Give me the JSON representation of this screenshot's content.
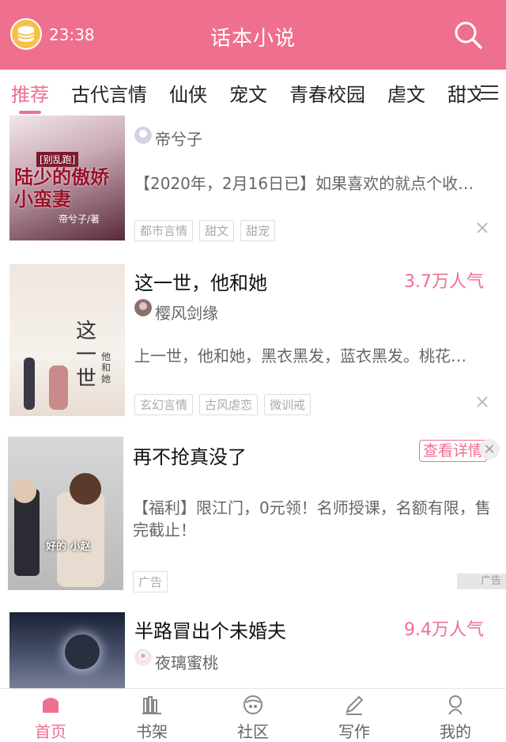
{
  "status": {
    "time": "23:38"
  },
  "header": {
    "title": "话本小说",
    "coin_icon": "coin-icon",
    "search_icon": "search-icon"
  },
  "tabs": [
    {
      "label": "推荐",
      "active": true
    },
    {
      "label": "古代言情"
    },
    {
      "label": "仙侠"
    },
    {
      "label": "宠文"
    },
    {
      "label": "青春校园"
    },
    {
      "label": "虐文"
    },
    {
      "label": "甜文"
    }
  ],
  "cards": [
    {
      "cover_text": {
        "top": "[别乱跑]",
        "main": "陆少的傲娇小蛮妻",
        "author": "帝兮子/著"
      },
      "author": "帝兮子",
      "desc": "【2020年，2月16日已】如果喜欢的就点个收藏…",
      "tags": [
        "都市言情",
        "甜文",
        "甜宠"
      ]
    },
    {
      "title": "这一世，他和她",
      "popularity": "3.7万人气",
      "author": "樱风剑缘",
      "desc": "上一世，他和她，黑衣黑发，蓝衣黑发。桃花…",
      "tags": [
        "玄幻言情",
        "古风虐恋",
        "微训戒"
      ],
      "cover_text": {
        "main": "这一世",
        "side": "他和她"
      }
    },
    {
      "title": "再不抢真没了",
      "detail_label": "查看详情",
      "desc": "【福利】限江门，0元领！名师授课，名额有限，售完截止！",
      "tags": [
        "广告"
      ],
      "ad_mark": "广告",
      "cover_text": {
        "caption": "好的 小赵"
      }
    },
    {
      "title": "半路冒出个未婚夫",
      "popularity": "9.4万人气",
      "author": "夜璃蜜桃"
    }
  ],
  "bottom_nav": [
    {
      "label": "首页",
      "active": true
    },
    {
      "label": "书架"
    },
    {
      "label": "社区"
    },
    {
      "label": "写作"
    },
    {
      "label": "我的"
    }
  ],
  "colors": {
    "brand": "#ef6f8f"
  }
}
